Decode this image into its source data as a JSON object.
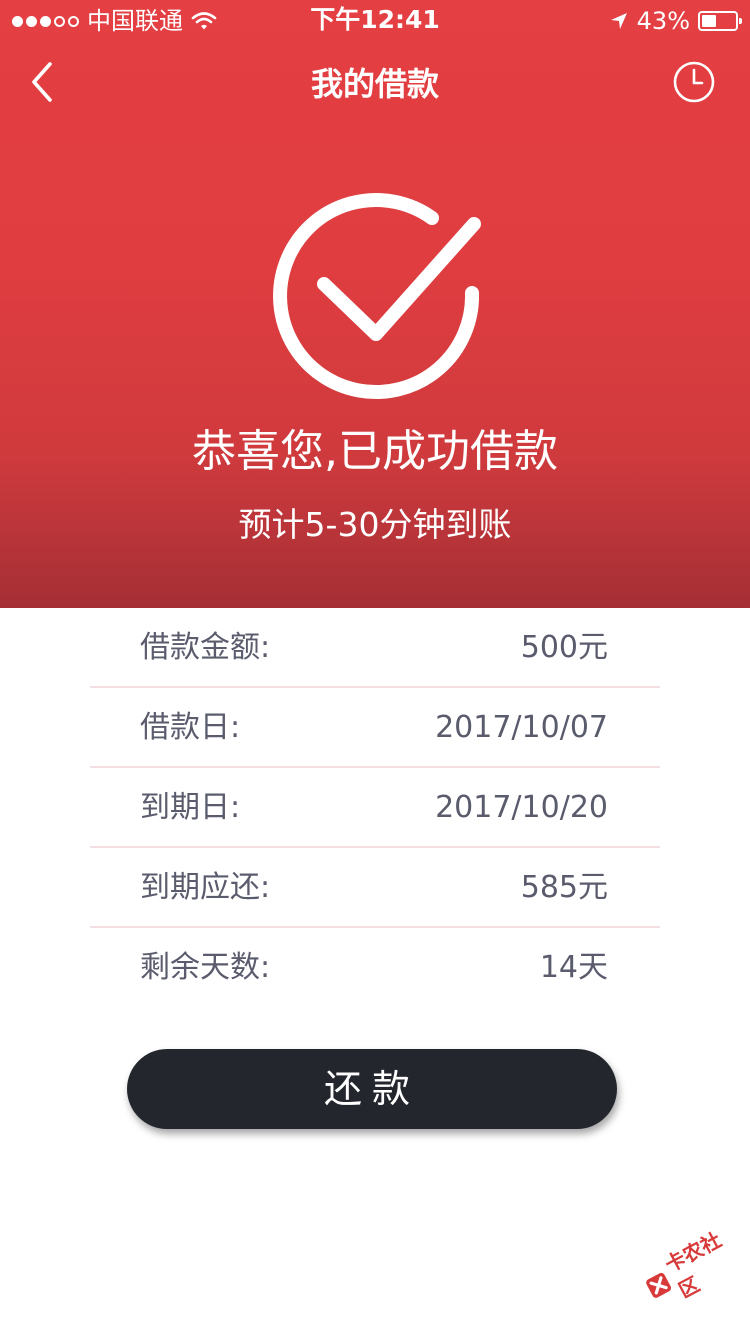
{
  "status_bar": {
    "carrier": "中国联通",
    "time": "下午12:41",
    "battery_percent": "43%",
    "battery_level": 0.43,
    "signal_bars_filled": 3,
    "signal_bars_total": 5
  },
  "nav": {
    "title": "我的借款",
    "back_icon": "chevron-left-icon",
    "history_icon": "clock-icon"
  },
  "hero": {
    "icon": "check-circle-icon",
    "title": "恭喜您,已成功借款",
    "subtitle": "预计5-30分钟到账"
  },
  "details": [
    {
      "label": "借款金额:",
      "value": "500元"
    },
    {
      "label": "借款日:",
      "value": "2017/10/07"
    },
    {
      "label": "到期日:",
      "value": "2017/10/20"
    },
    {
      "label": "到期应还:",
      "value": "585元"
    },
    {
      "label": "剩余天数:",
      "value": "14天"
    }
  ],
  "actions": {
    "repay_label": "还款"
  },
  "watermark": {
    "text": "卡农社区"
  },
  "colors": {
    "header_red": "#e43f42",
    "button_dark": "#23262d",
    "text_gray": "#5a5c6d",
    "divider": "#f3dfe2"
  }
}
